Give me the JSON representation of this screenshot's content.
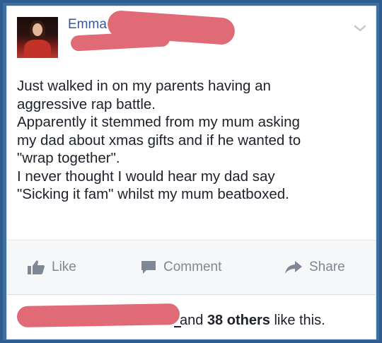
{
  "post": {
    "author_name": "Emma",
    "lines": [
      "Just walked in on my parents having an",
      "aggressive rap battle.",
      "Apparently it stemmed from my mum asking",
      "my dad about xmas gifts and if he wanted to",
      "\"wrap together\".",
      "I never thought I would hear my dad say",
      "\"Sicking it fam\" whilst my mum beatboxed."
    ]
  },
  "actions": {
    "like_label": "Like",
    "comment_label": "Comment",
    "share_label": "Share"
  },
  "likes": {
    "prefix": "and",
    "count": "38 others",
    "suffix": "like this."
  },
  "colors": {
    "link_blue": "#3b5998",
    "redaction": "#e06a76",
    "action_gray": "#7f8794"
  }
}
